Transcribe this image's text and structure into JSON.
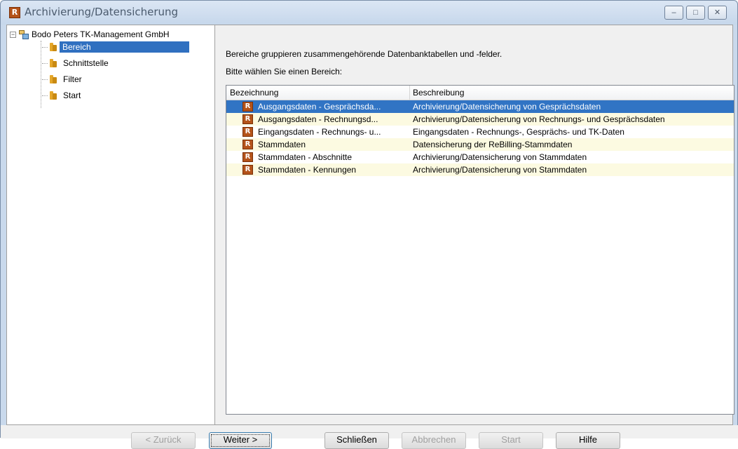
{
  "window": {
    "title": "Archivierung/Datensicherung",
    "app_icon_letter": "R",
    "controls": {
      "minimize": "–",
      "maximize": "□",
      "close": "✕"
    }
  },
  "tree": {
    "root": "Bodo Peters TK-Management GmbH",
    "expander": "−",
    "items": [
      {
        "label": "Bereich",
        "selected": true
      },
      {
        "label": "Schnittstelle",
        "selected": false
      },
      {
        "label": "Filter",
        "selected": false
      },
      {
        "label": "Start",
        "selected": false
      }
    ]
  },
  "main": {
    "description": "Bereiche gruppieren zusammengehörende Datenbanktabellen und -felder.",
    "prompt": "Bitte wählen Sie einen Bereich:",
    "columns": [
      "Bezeichnung",
      "Beschreibung"
    ],
    "rows": [
      {
        "icon": "R",
        "name": "Ausgangsdaten - Gesprächsda...",
        "desc": "Archivierung/Datensicherung von Gesprächsdaten"
      },
      {
        "icon": "R",
        "name": "Ausgangsdaten - Rechnungsd...",
        "desc": "Archivierung/Datensicherung von Rechnungs- und Gesprächsdaten"
      },
      {
        "icon": "R",
        "name": "Eingangsdaten - Rechnungs- u...",
        "desc": "Eingangsdaten - Rechnungs-, Gesprächs- und TK-Daten"
      },
      {
        "icon": "R",
        "name": "Stammdaten",
        "desc": "Datensicherung der ReBilling-Stammdaten"
      },
      {
        "icon": "R",
        "name": "Stammdaten - Abschnitte",
        "desc": "Archivierung/Datensicherung von Stammdaten"
      },
      {
        "icon": "R",
        "name": "Stammdaten - Kennungen",
        "desc": "Archivierung/Datensicherung von Stammdaten"
      }
    ],
    "selected_row": 0
  },
  "buttons": {
    "back": "< Zurück",
    "next": "Weiter >",
    "close": "Schließen",
    "cancel": "Abbrechen",
    "start": "Start",
    "help": "Hilfe"
  },
  "colors": {
    "selection": "#3174c4",
    "alt_row": "#fcfae1",
    "window_frame": "#c9d9ec"
  }
}
